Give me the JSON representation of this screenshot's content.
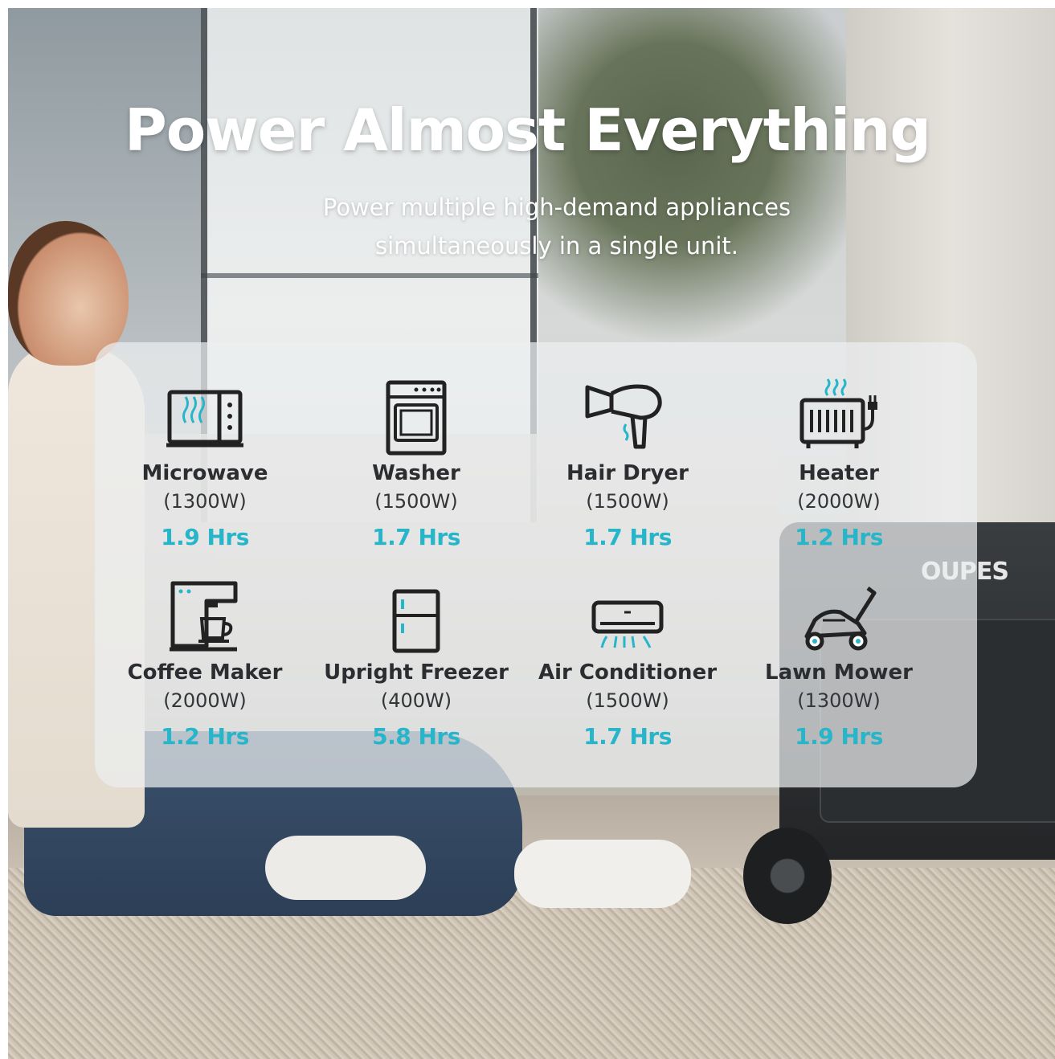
{
  "header": {
    "title": "Power Almost Everything",
    "subtitle_line1": "Power multiple high-demand appliances",
    "subtitle_line2": "simultaneously in a single unit."
  },
  "brand": "OUPES",
  "accent_color": "#27b5c9",
  "appliances": [
    {
      "name": "Microwave",
      "watts": "(1300W)",
      "runtime": "1.9 Hrs",
      "icon": "microwave-icon"
    },
    {
      "name": "Washer",
      "watts": "(1500W)",
      "runtime": "1.7 Hrs",
      "icon": "washer-icon"
    },
    {
      "name": "Hair Dryer",
      "watts": "(1500W)",
      "runtime": "1.7 Hrs",
      "icon": "hair-dryer-icon"
    },
    {
      "name": "Heater",
      "watts": "(2000W)",
      "runtime": "1.2 Hrs",
      "icon": "heater-icon"
    },
    {
      "name": "Coffee Maker",
      "watts": "(2000W)",
      "runtime": "1.2 Hrs",
      "icon": "coffee-maker-icon"
    },
    {
      "name": "Upright Freezer",
      "watts": "(400W)",
      "runtime": "5.8 Hrs",
      "icon": "freezer-icon"
    },
    {
      "name": "Air Conditioner",
      "watts": "(1500W)",
      "runtime": "1.7 Hrs",
      "icon": "air-conditioner-icon"
    },
    {
      "name": "Lawn Mower",
      "watts": "(1300W)",
      "runtime": "1.9 Hrs",
      "icon": "lawn-mower-icon"
    }
  ]
}
